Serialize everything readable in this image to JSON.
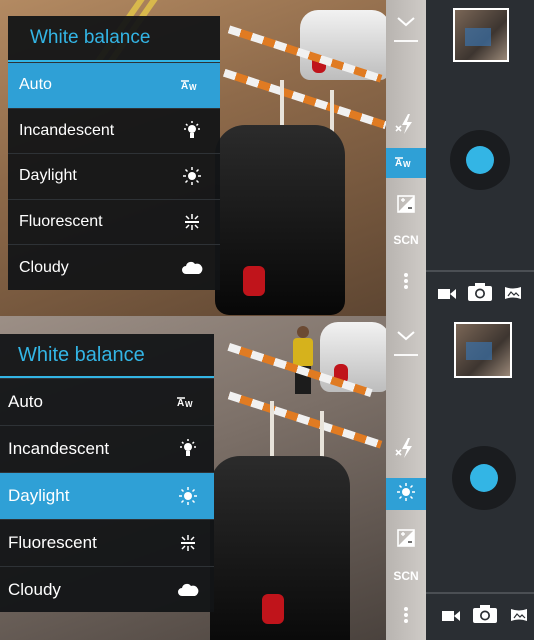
{
  "screens": [
    {
      "menu": {
        "title": "White balance",
        "items": [
          {
            "label": "Auto",
            "icon": "auto-wb-icon",
            "selected": true
          },
          {
            "label": "Incandescent",
            "icon": "incandescent-icon",
            "selected": false
          },
          {
            "label": "Daylight",
            "icon": "sun-icon",
            "selected": false
          },
          {
            "label": "Fluorescent",
            "icon": "fluorescent-icon",
            "selected": false
          },
          {
            "label": "Cloudy",
            "icon": "cloud-icon",
            "selected": false
          }
        ]
      },
      "controls": {
        "scene_label": "SCN",
        "active": "white-balance"
      }
    },
    {
      "menu": {
        "title": "White balance",
        "items": [
          {
            "label": "Auto",
            "icon": "auto-wb-icon",
            "selected": false
          },
          {
            "label": "Incandescent",
            "icon": "incandescent-icon",
            "selected": false
          },
          {
            "label": "Daylight",
            "icon": "sun-icon",
            "selected": true
          },
          {
            "label": "Fluorescent",
            "icon": "fluorescent-icon",
            "selected": false
          },
          {
            "label": "Cloudy",
            "icon": "cloud-icon",
            "selected": false
          }
        ]
      },
      "controls": {
        "scene_label": "SCN",
        "active": "white-balance"
      }
    }
  ],
  "colors": {
    "accent": "#33b5e5",
    "selected_bg": "#2fa0d6",
    "menu_bg": "#121416"
  }
}
